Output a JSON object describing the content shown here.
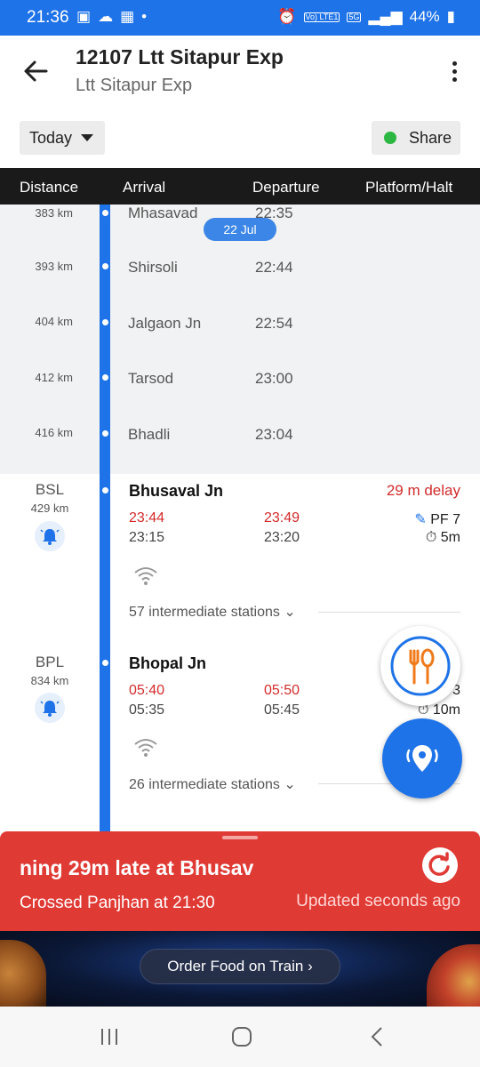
{
  "status_bar": {
    "time": "21:36",
    "battery": "44%",
    "network": "5G",
    "volte": "Vo) LTE1"
  },
  "header": {
    "train_title": "12107 Ltt Sitapur Exp",
    "train_subtitle": "Ltt Sitapur Exp"
  },
  "controls": {
    "day_selector": "Today",
    "share_label": "Share"
  },
  "table_header": {
    "distance": "Distance",
    "arrival": "Arrival",
    "departure": "Departure",
    "platform_halt": "Platform/Halt"
  },
  "date_pill": "22 Jul",
  "intermediate_stops": [
    {
      "km": "383 km",
      "name": "Mhasavad",
      "time": "22:35"
    },
    {
      "km": "393 km",
      "name": "Shirsoli",
      "time": "22:44"
    },
    {
      "km": "404 km",
      "name": "Jalgaon Jn",
      "time": "22:54"
    },
    {
      "km": "412 km",
      "name": "Tarsod",
      "time": "23:00"
    },
    {
      "km": "416 km",
      "name": "Bhadli",
      "time": "23:04"
    }
  ],
  "stations": [
    {
      "code": "BSL",
      "km": "429 km",
      "name": "Bhusaval Jn",
      "status": "29 m delay",
      "arr_actual": "23:44",
      "arr_sched": "23:15",
      "dep_actual": "23:49",
      "dep_sched": "23:20",
      "platform": "PF 7",
      "halt": "5m",
      "intermediate": "57 intermediate stations"
    },
    {
      "code": "BPL",
      "km": "834 km",
      "name": "Bhopal  Jn",
      "status": "",
      "arr_actual": "05:40",
      "arr_sched": "05:35",
      "dep_actual": "05:50",
      "dep_sched": "05:45",
      "platform": "3",
      "halt": "10m",
      "intermediate": "26 intermediate stations"
    }
  ],
  "live_status": {
    "running": "ning 29m late at Bhusav",
    "crossed": "Crossed Panjhan at 21:30",
    "updated": "Updated seconds  ago"
  },
  "banner": {
    "order_food": "Order Food on Train  ›"
  },
  "colors": {
    "primary": "#1e73e8",
    "delay_red": "#d32b2b",
    "panel_red": "#e03a35"
  }
}
